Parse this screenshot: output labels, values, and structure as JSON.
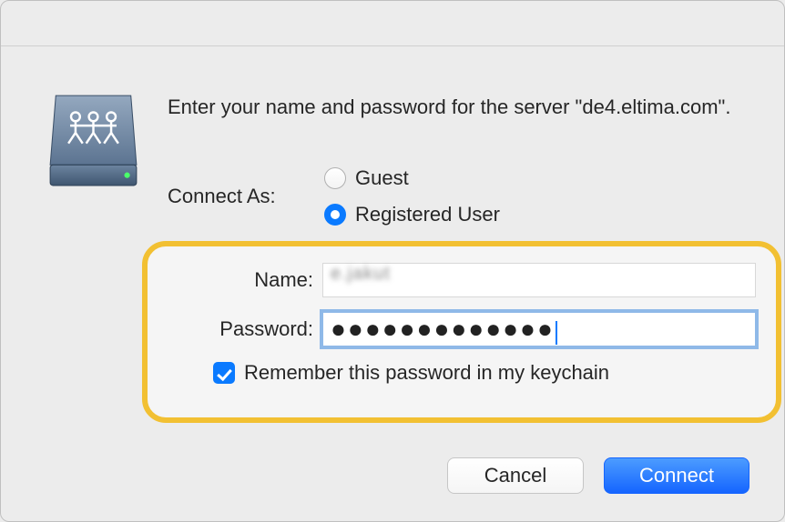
{
  "prompt": "Enter your name and password for the server \"de4.eltima.com\".",
  "connect_as_label": "Connect As:",
  "radio_guest": "Guest",
  "radio_registered": "Registered User",
  "selected_radio": "registered",
  "name": {
    "label": "Name:",
    "value": "e.jakut"
  },
  "password": {
    "label": "Password:",
    "value": "●●●●●●●●●●●●●"
  },
  "remember": {
    "label": "Remember this password in my keychain",
    "checked": true
  },
  "buttons": {
    "cancel": "Cancel",
    "connect": "Connect"
  }
}
